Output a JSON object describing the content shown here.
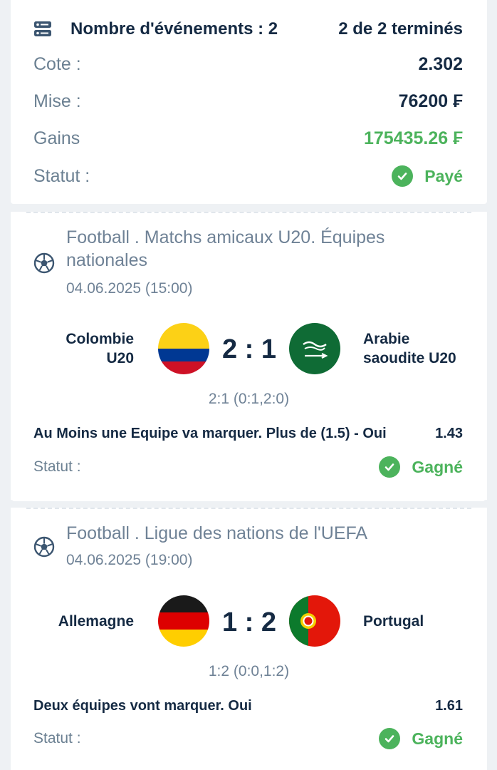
{
  "summary": {
    "events_label": "Nombre d'événements : 2",
    "completed_label": "2 de 2 terminés",
    "rows": [
      {
        "label": "Cote :",
        "value": "2.302"
      },
      {
        "label": "Mise :",
        "value": "76200 ₣"
      },
      {
        "label": "Gains",
        "value": "175435.26 ₣"
      }
    ],
    "status_label": "Statut :",
    "status_value": "Payé"
  },
  "events": [
    {
      "title": "Football . Matchs amicaux U20. Équipes nationales",
      "date": "04.06.2025 (15:00)",
      "home": [
        "Colombie",
        "U20"
      ],
      "away": [
        "Arabie",
        "saoudite U20"
      ],
      "score": "2 : 1",
      "detail": "2:1 (0:1,2:0)",
      "market": "Au Moins une Equipe va marquer. Plus de (1.5) - Oui",
      "odds": "1.43",
      "status_label": "Statut :",
      "status_value": "Gagné"
    },
    {
      "title": "Football . Ligue des nations de l'UEFA",
      "date": "04.06.2025 (19:00)",
      "home": [
        "Allemagne"
      ],
      "away": [
        "Portugal"
      ],
      "score": "1 : 2",
      "detail": "1:2 (0:0,1:2)",
      "market": "Deux équipes vont marquer. Oui",
      "odds": "1.61",
      "status_label": "Statut :",
      "status_value": "Gagné"
    }
  ],
  "colors": {
    "primary_text": "#152a43",
    "muted_text": "#6f8296",
    "success": "#4cb35c",
    "background": "#eef1f4"
  },
  "icons": {
    "summary": "list-icon",
    "sport": "soccer-ball-icon",
    "status": "check-circle-icon"
  }
}
